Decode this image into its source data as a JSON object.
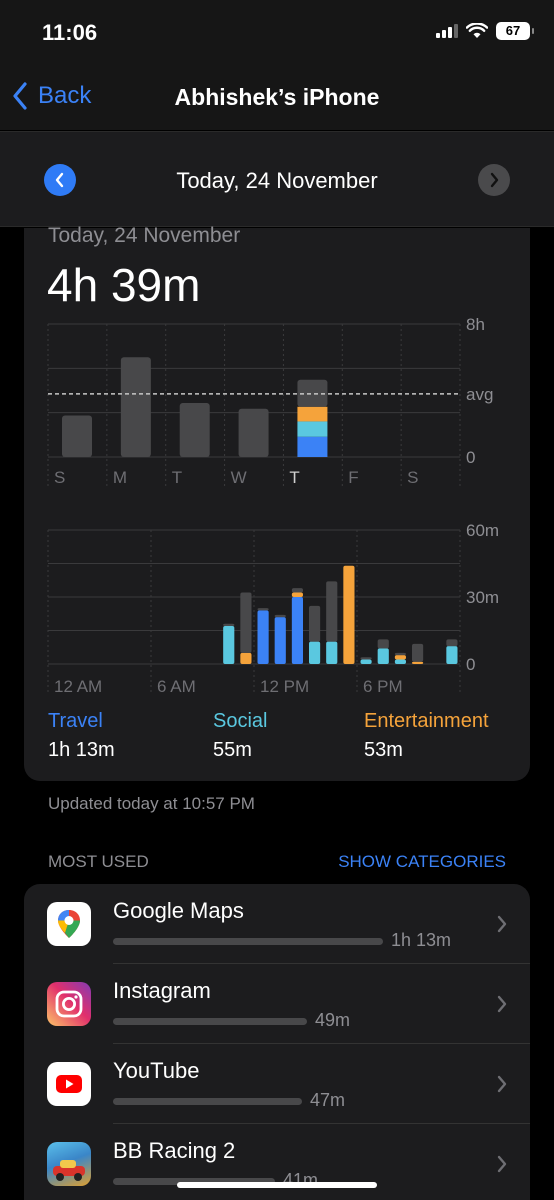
{
  "status": {
    "time": "11:06",
    "battery": "67"
  },
  "nav": {
    "back_label": "Back",
    "title": "Abhishek’s iPhone"
  },
  "date_bar": {
    "label": "Today, 24 November"
  },
  "summary": {
    "date": "Today, 24 November",
    "total": "4h 39m",
    "legend": [
      {
        "name": "Travel",
        "value": "1h 13m",
        "color": "#3b82f6"
      },
      {
        "name": "Social",
        "value": "55m",
        "color": "#5ac8e0"
      },
      {
        "name": "Entertainment",
        "value": "53m",
        "color": "#f5a33b"
      }
    ]
  },
  "chart_data": [
    {
      "type": "bar",
      "title": "",
      "categories": [
        "S",
        "M",
        "T",
        "W",
        "T",
        "F",
        "S"
      ],
      "values_hours": [
        2.5,
        6.0,
        3.25,
        2.9,
        4.65,
        0,
        0
      ],
      "today_breakdown": {
        "Travel": 1.22,
        "Social": 0.92,
        "Entertainment": 0.88,
        "Other": 1.63
      },
      "y_tick_labels": [
        "8h",
        "avg",
        "0"
      ],
      "ylim": [
        0,
        8
      ],
      "average_hours": 3.8,
      "highlighted_category": 4
    },
    {
      "type": "bar",
      "title": "",
      "x_tick_labels": [
        "12 AM",
        "6 AM",
        "12 PM",
        "6 PM"
      ],
      "y_tick_labels": [
        "60m",
        "30m",
        "0"
      ],
      "ylim": [
        0,
        60
      ],
      "series": [
        {
          "name": "Travel",
          "values": [
            0,
            0,
            0,
            0,
            0,
            0,
            0,
            0,
            0,
            0,
            0,
            0,
            24,
            21,
            30,
            0,
            0,
            0,
            0,
            0,
            0,
            0,
            0,
            0
          ]
        },
        {
          "name": "Social",
          "values": [
            0,
            0,
            0,
            0,
            0,
            0,
            0,
            0,
            0,
            0,
            17,
            0,
            0,
            0,
            0,
            10,
            10,
            0,
            2,
            7,
            2,
            0,
            0,
            8
          ]
        },
        {
          "name": "Entertainment",
          "values": [
            0,
            0,
            0,
            0,
            0,
            0,
            0,
            0,
            0,
            0,
            0,
            5,
            0,
            0,
            2,
            0,
            0,
            44,
            0,
            0,
            2,
            1,
            0,
            0
          ]
        },
        {
          "name": "Other",
          "values": [
            0,
            0,
            0,
            0,
            0,
            0,
            0,
            0,
            0,
            0,
            1,
            27,
            1,
            1,
            2,
            16,
            27,
            0,
            1,
            4,
            1,
            8,
            0,
            3
          ]
        }
      ]
    }
  ],
  "updated_text": "Updated today at 10:57 PM",
  "most_used": {
    "heading": "MOST USED",
    "link": "SHOW CATEGORIES",
    "apps": [
      {
        "name": "Google Maps",
        "duration": "1h 13m",
        "usage_fraction": 1.0
      },
      {
        "name": "Instagram",
        "duration": "49m",
        "usage_fraction": 0.72
      },
      {
        "name": "YouTube",
        "duration": "47m",
        "usage_fraction": 0.7
      },
      {
        "name": "BB Racing 2",
        "duration": "41m",
        "usage_fraction": 0.6
      }
    ]
  },
  "colors": {
    "accent": "#3b82f6",
    "travel": "#3b82f6",
    "social": "#5ac8e0",
    "entertainment": "#f5a33b",
    "other": "#48484a"
  }
}
